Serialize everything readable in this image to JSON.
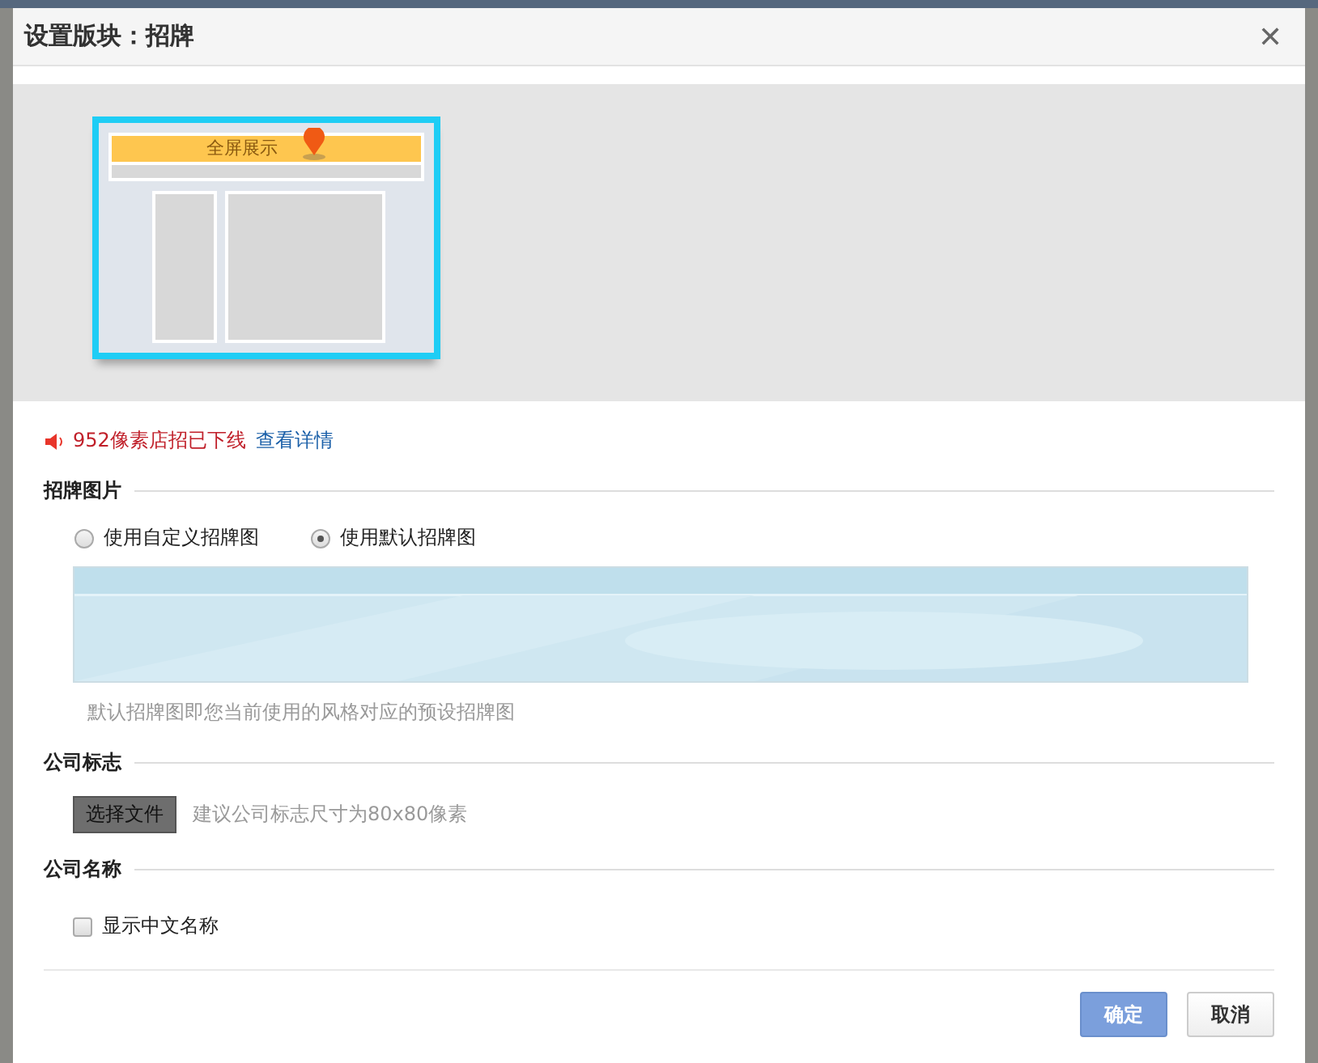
{
  "dialog": {
    "title": "设置版块：招牌",
    "close": "✕"
  },
  "preview": {
    "banner_label": "全屏展示"
  },
  "notice": {
    "text": "952像素店招已下线",
    "link": "查看详情"
  },
  "sections": [
    {
      "kind": "radio",
      "title": "招牌图片",
      "options": [
        {
          "label": "使用自定义招牌图",
          "selected": false
        },
        {
          "label": "使用默认招牌图",
          "selected": true
        }
      ],
      "hint": "默认招牌图即您当前使用的风格对应的预设招牌图"
    },
    {
      "kind": "file",
      "title": "公司标志",
      "button": "选择文件",
      "hint": "建议公司标志尺寸为80x80像素"
    },
    {
      "kind": "checkbox",
      "title": "公司名称",
      "label": "显示中文名称",
      "checked": false
    }
  ],
  "buttons": [
    {
      "label": "确定",
      "primary": true
    },
    {
      "label": "取消",
      "primary": false
    }
  ]
}
